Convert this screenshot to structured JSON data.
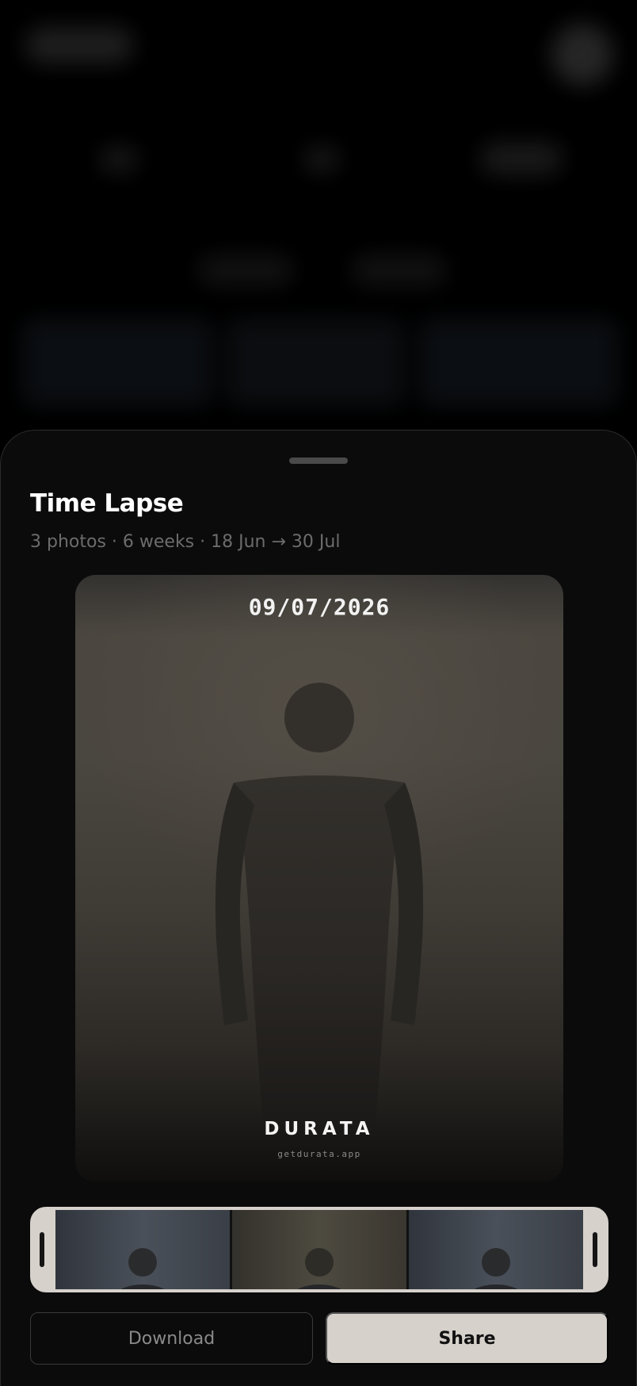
{
  "sheet": {
    "title": "Time Lapse",
    "subtitle": "3 photos · 6 weeks · 18 Jun → 30 Jul"
  },
  "preview": {
    "date": "09/07/2026",
    "brand": "DURATA",
    "brand_url": "getdurata.app"
  },
  "filmstrip": {
    "frames": [
      {
        "tone": "cool"
      },
      {
        "tone": "warm"
      },
      {
        "tone": "cool"
      }
    ]
  },
  "actions": {
    "download_label": "Download",
    "share_label": "Share"
  },
  "colors": {
    "sheet_bg": "#0b0b0b",
    "accent_light": "#d6d1cb",
    "subtitle": "#6c6c6c"
  }
}
